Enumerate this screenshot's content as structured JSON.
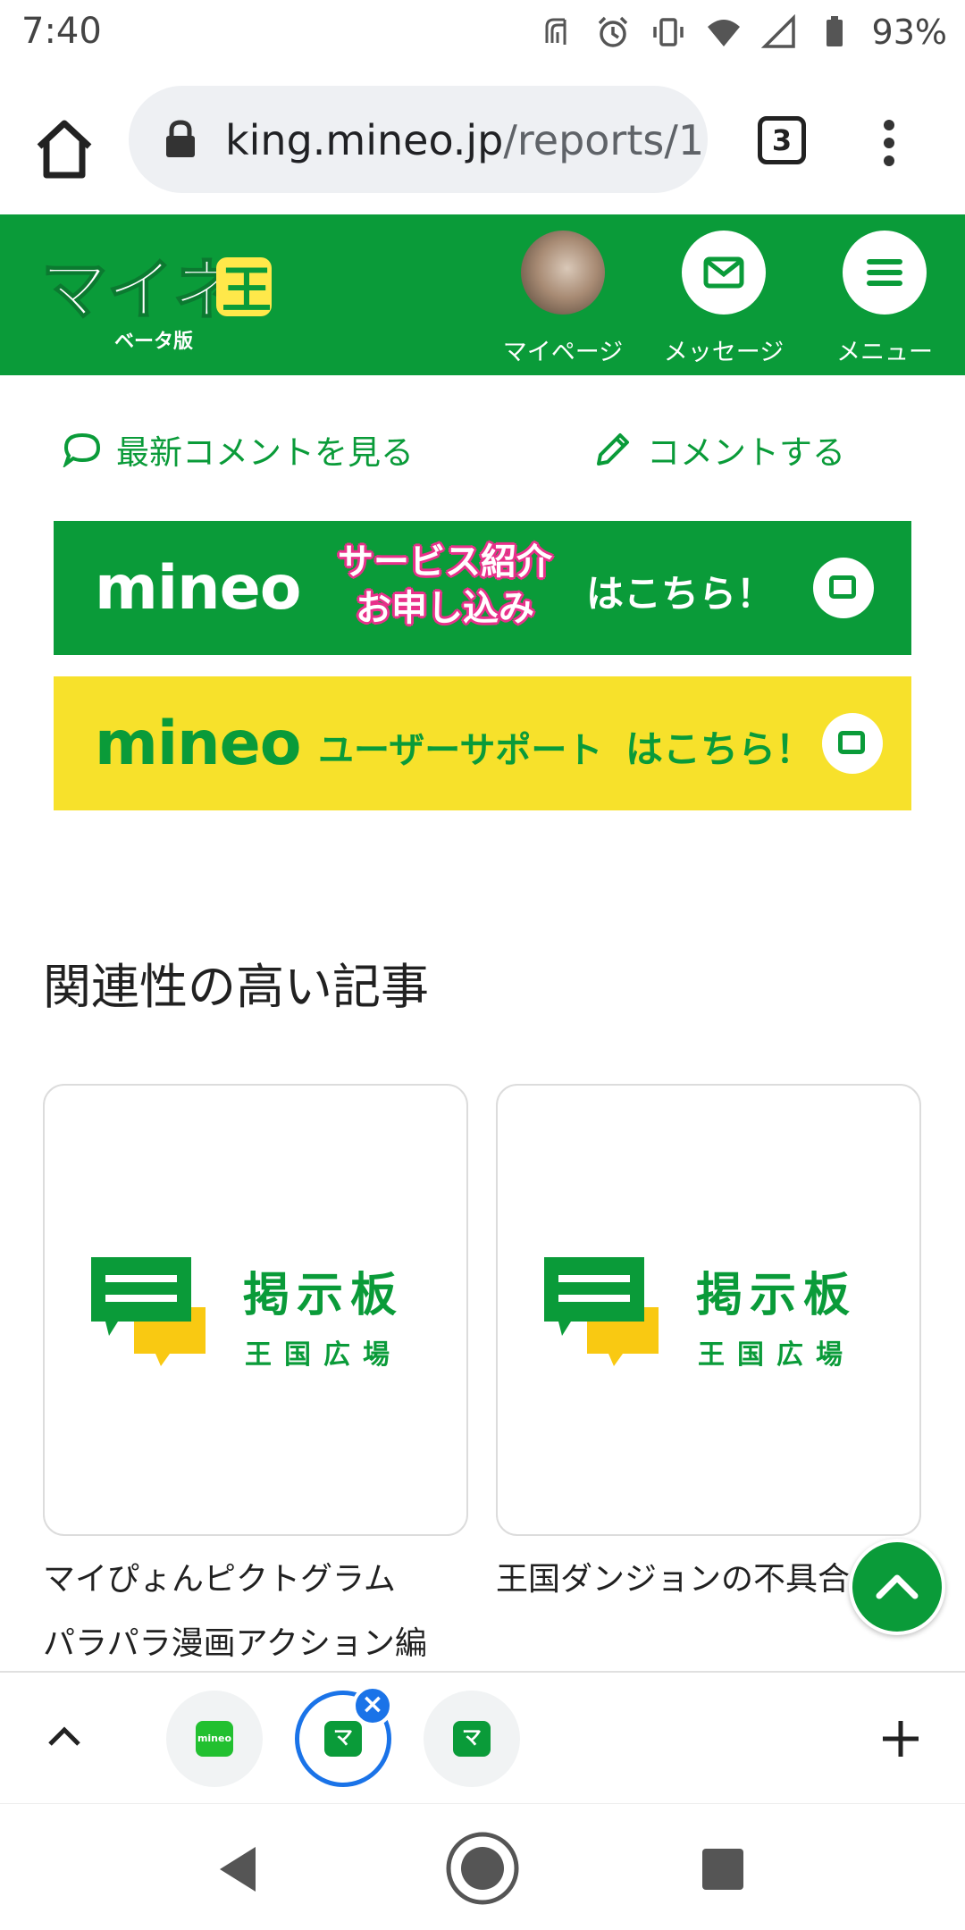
{
  "status_bar": {
    "time": "7:40",
    "battery": "93%",
    "icons": [
      "nfc-icon",
      "alarm-icon",
      "vibrate-icon",
      "wifi-icon",
      "signal-icon",
      "battery-icon"
    ]
  },
  "browser": {
    "url_host": "king.mineo.jp",
    "url_path": "/reports/1:",
    "tab_count": "3"
  },
  "site_header": {
    "logo_text": "マイネ王",
    "logo_sub": "ベータ版",
    "items": [
      {
        "label": "マイページ",
        "icon": "avatar"
      },
      {
        "label": "メッセージ",
        "icon": "mail-icon"
      },
      {
        "label": "メニュー",
        "icon": "menu-icon"
      }
    ]
  },
  "comment_links": {
    "latest": "最新コメントを見る",
    "write": "コメントする"
  },
  "banners": {
    "service": {
      "brand": "mineo",
      "highlight_line1": "サービス紹介",
      "highlight_line2": "お申し込み",
      "suffix": "はこちら！"
    },
    "support": {
      "brand": "mineo",
      "text": "ユーザーサポート",
      "suffix": "はこちら！"
    }
  },
  "related": {
    "title": "関連性の高い記事",
    "cards": [
      {
        "board_title": "掲示板",
        "board_sub": "王国広場",
        "title_line1": "マイぴょんピクトグラム",
        "title_line2": "パラパラ漫画アクション編"
      },
      {
        "board_title": "掲示板",
        "board_sub": "王国広場",
        "title_line1": "王国ダンジョンの不具合",
        "title_line2": ""
      }
    ]
  },
  "tab_strip": {
    "tabs": [
      {
        "favicon_text": "mineo",
        "active": false
      },
      {
        "favicon_text": "マ",
        "active": true
      },
      {
        "favicon_text": "マ",
        "active": false
      }
    ]
  },
  "colors": {
    "brand_green": "#0a9b39",
    "banner_yellow": "#f7e12b",
    "accent_pink": "#e8308a",
    "chrome_blue": "#1a73e8"
  }
}
